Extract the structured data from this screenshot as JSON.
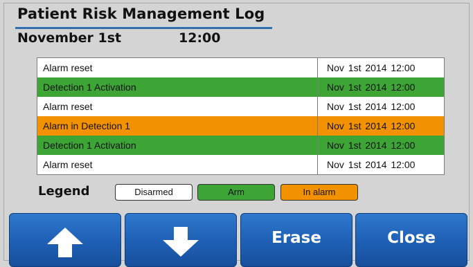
{
  "header": {
    "title": "Patient Risk Management Log",
    "date": "November 1st",
    "time": "12:00"
  },
  "log": {
    "rows": [
      {
        "event": "Alarm reset",
        "timestamp": "Nov 1st 2014 12:00",
        "status": "disarmed"
      },
      {
        "event": "Detection 1 Activation",
        "timestamp": "Nov 1st 2014 12:00",
        "status": "arm"
      },
      {
        "event": "Alarm reset",
        "timestamp": "Nov 1st 2014 12:00",
        "status": "disarmed"
      },
      {
        "event": "Alarm in Detection 1",
        "timestamp": "Nov 1st 2014 12:00",
        "status": "alarm"
      },
      {
        "event": "Detection 1 Activation",
        "timestamp": "Nov 1st 2014 12:00",
        "status": "arm"
      },
      {
        "event": "Alarm reset",
        "timestamp": "Nov 1st 2014 12:00",
        "status": "disarmed"
      }
    ]
  },
  "legend": {
    "label": "Legend",
    "items": [
      {
        "label": "Disarmed",
        "color": "#ffffff"
      },
      {
        "label": "Arm",
        "color": "#3da535"
      },
      {
        "label": "In alarm",
        "color": "#f39200"
      }
    ]
  },
  "buttons": {
    "up_icon": "arrow-up-icon",
    "down_icon": "arrow-down-icon",
    "erase_label": "Erase",
    "close_label": "Close"
  },
  "colors": {
    "accent": "#2e6fb0",
    "button": "#1f61b6",
    "arm": "#3da535",
    "alarm": "#f39200",
    "background": "#d4d4d4"
  }
}
